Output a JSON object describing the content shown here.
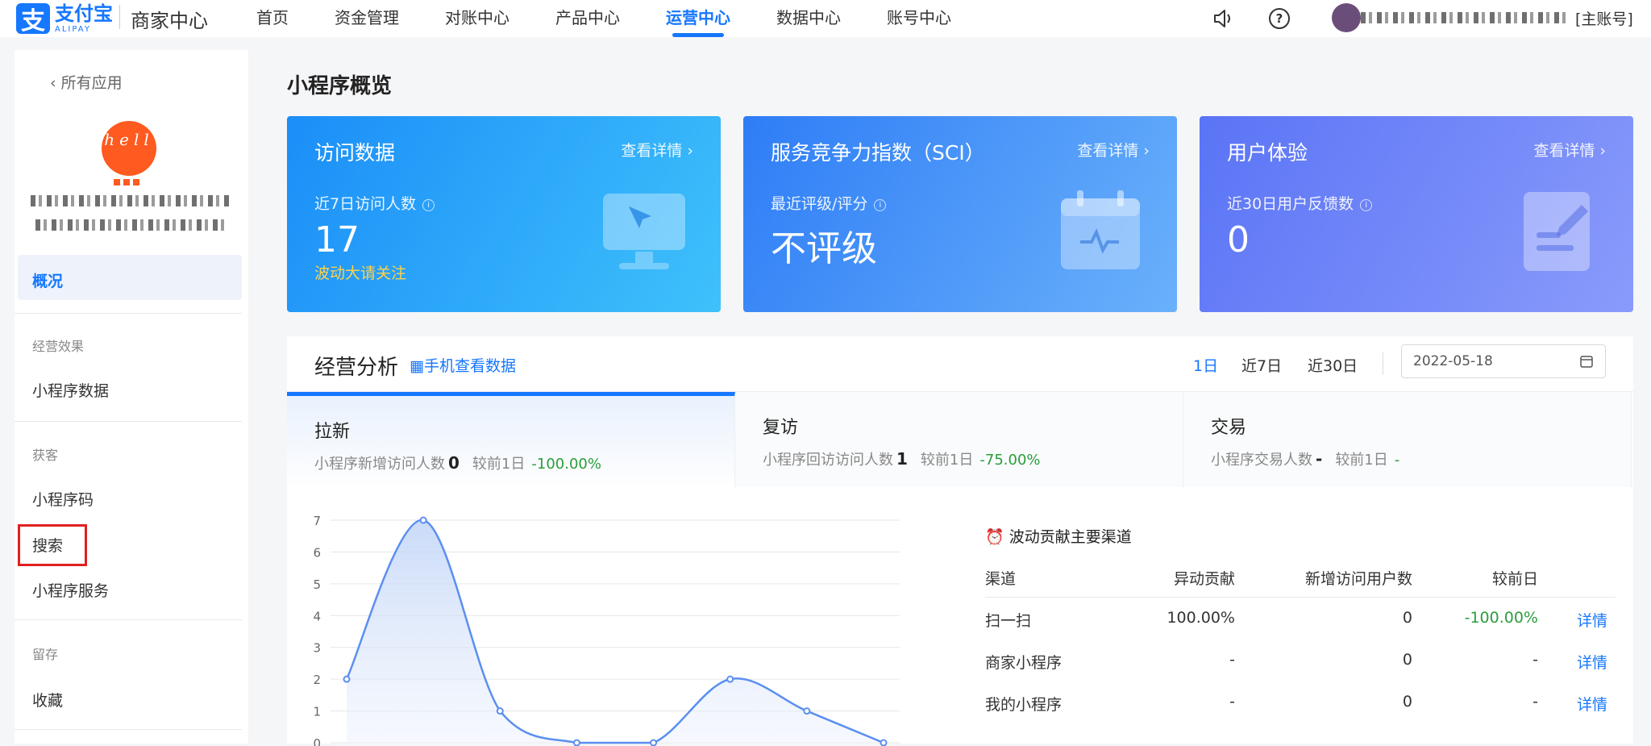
{
  "header": {
    "logo_cn": "支付宝",
    "logo_en": "ALIPAY",
    "title": "商家中心",
    "nav": [
      "首页",
      "资金管理",
      "对账中心",
      "产品中心",
      "运营中心",
      "数据中心",
      "账号中心"
    ],
    "active_nav": "运营中心",
    "account_tag": "[主账号]",
    "icons": [
      "speaker-icon",
      "help-icon"
    ]
  },
  "sidebar": {
    "back": "所有应用",
    "app_avatar_text": "hell",
    "items": [
      {
        "label": "概况",
        "active": true
      },
      {
        "group": "经营效果"
      },
      {
        "label": "小程序数据"
      },
      {
        "group": "获客"
      },
      {
        "label": "小程序码"
      },
      {
        "label": "搜索",
        "highlighted": true
      },
      {
        "label": "小程序服务"
      },
      {
        "group": "留存"
      },
      {
        "label": "收藏"
      }
    ]
  },
  "page_title": "小程序概览",
  "cards": [
    {
      "title": "访问数据",
      "link": "查看详情",
      "label": "近7日访问人数",
      "value": "17",
      "hint": "波动大请关注",
      "icon": "monitor-cursor-icon"
    },
    {
      "title": "服务竞争力指数（SCI）",
      "link": "查看详情",
      "label": "最近评级/评分",
      "value": "不评级",
      "hint": "",
      "icon": "calendar-pulse-icon"
    },
    {
      "title": "用户体验",
      "link": "查看详情",
      "label": "近30日用户反馈数",
      "value": "0",
      "hint": "",
      "icon": "document-edit-icon"
    }
  ],
  "analysis": {
    "title": "经营分析",
    "link": "手机查看数据",
    "ranges": [
      "1日",
      "近7日",
      "近30日"
    ],
    "active_range": "1日",
    "date": "2022-05-18",
    "tabs": [
      {
        "title": "拉新",
        "metric": "小程序新增访问人数",
        "value": "0",
        "compare": "较前1日",
        "change": "-100.00%"
      },
      {
        "title": "复访",
        "metric": "小程序回访访问人数",
        "value": "1",
        "compare": "较前1日",
        "change": "-75.00%"
      },
      {
        "title": "交易",
        "metric": "小程序交易人数",
        "value": "-",
        "compare": "较前1日",
        "change": "-"
      }
    ],
    "channels": {
      "title": "波动贡献主要渠道",
      "headers": [
        "渠道",
        "异动贡献",
        "新增访问用户数",
        "较前日",
        ""
      ],
      "rows": [
        {
          "channel": "扫一扫",
          "contribution": "100.00%",
          "new_users": "0",
          "change": "-100.00%",
          "link": "详情"
        },
        {
          "channel": "商家小程序",
          "contribution": "-",
          "new_users": "0",
          "change": "-",
          "link": "详情"
        },
        {
          "channel": "我的小程序",
          "contribution": "-",
          "new_users": "0",
          "change": "-",
          "link": "详情"
        }
      ]
    }
  },
  "chart_data": {
    "type": "area",
    "x": [
      1,
      2,
      3,
      4,
      5,
      6,
      7,
      8
    ],
    "values": [
      2,
      7,
      1,
      0,
      0,
      2,
      1,
      0
    ],
    "ylim": [
      0,
      7
    ],
    "yticks": [
      "0",
      "1",
      "2",
      "3",
      "4",
      "5",
      "6",
      "7"
    ],
    "grid": true,
    "color": "#5b8ff0"
  }
}
